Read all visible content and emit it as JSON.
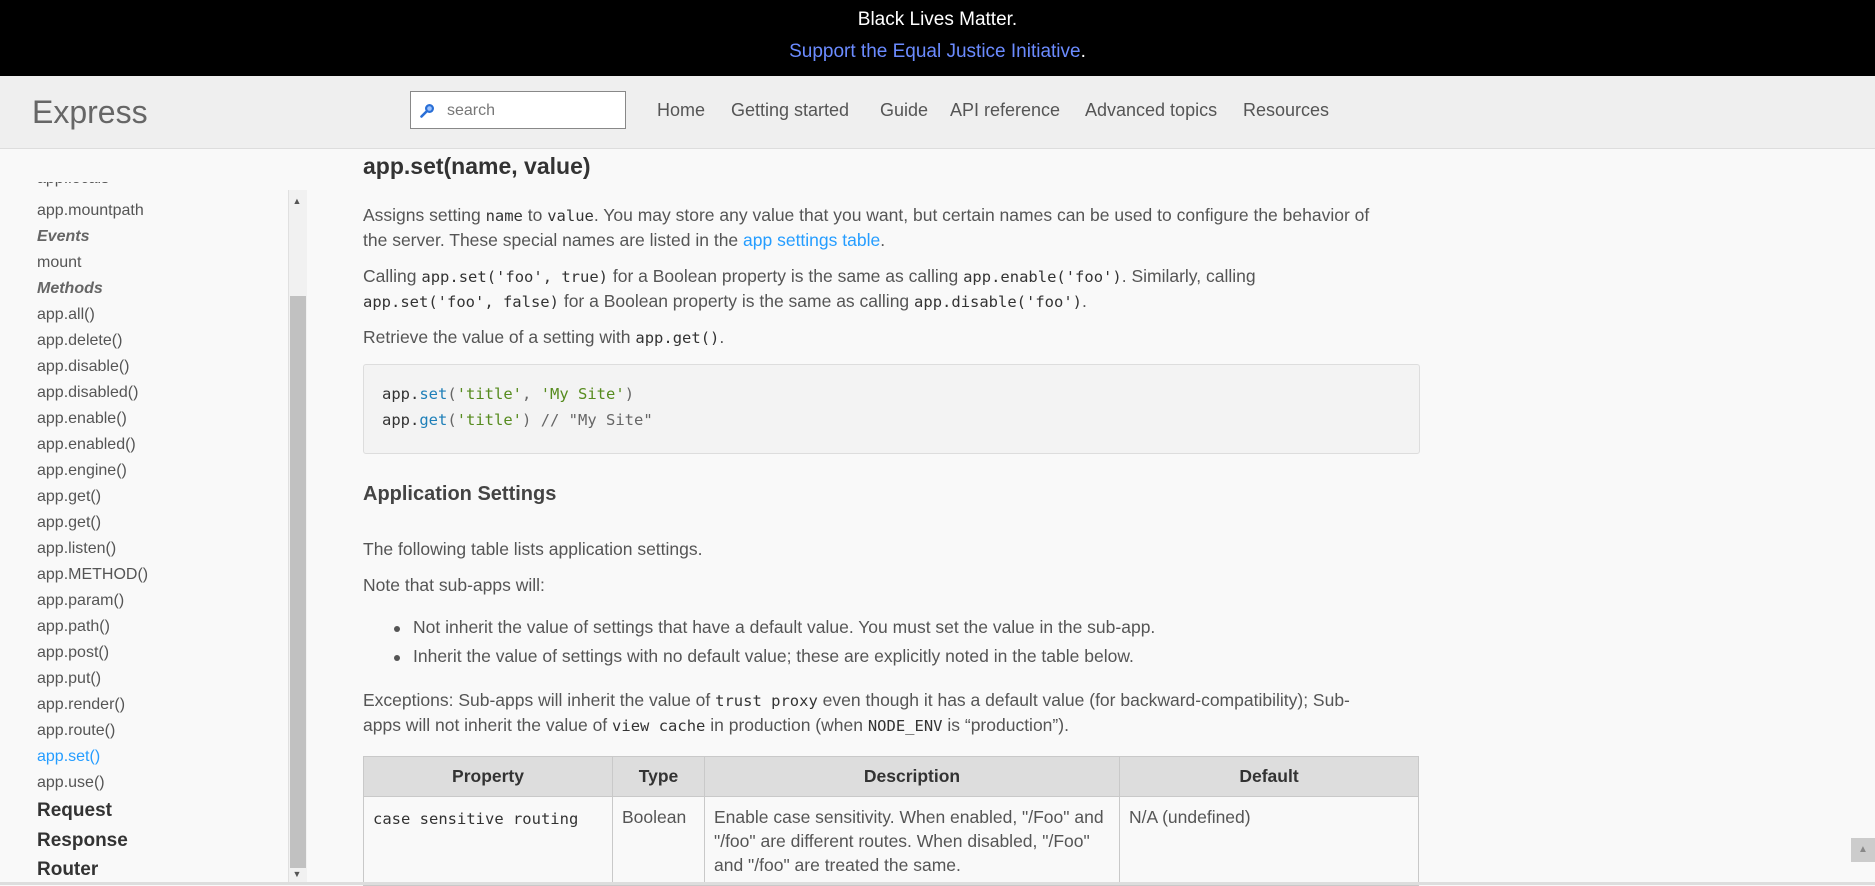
{
  "banner": {
    "line1": "Black Lives Matter.",
    "link": "Support the Equal Justice Initiative",
    "period": "."
  },
  "header": {
    "logo": "Express",
    "search_placeholder": "search",
    "nav": [
      "Home",
      "Getting started",
      "Guide",
      "API reference",
      "Advanced topics",
      "Resources"
    ]
  },
  "sidebar": {
    "clipped": "app.locals",
    "items": [
      {
        "label": "app.mountpath",
        "kind": "item"
      },
      {
        "label": "Events",
        "kind": "head"
      },
      {
        "label": "mount",
        "kind": "item"
      },
      {
        "label": "Methods",
        "kind": "head"
      },
      {
        "label": "app.all()",
        "kind": "item"
      },
      {
        "label": "app.delete()",
        "kind": "item"
      },
      {
        "label": "app.disable()",
        "kind": "item"
      },
      {
        "label": "app.disabled()",
        "kind": "item"
      },
      {
        "label": "app.enable()",
        "kind": "item"
      },
      {
        "label": "app.enabled()",
        "kind": "item"
      },
      {
        "label": "app.engine()",
        "kind": "item"
      },
      {
        "label": "app.get()",
        "kind": "item"
      },
      {
        "label": "app.get()",
        "kind": "item"
      },
      {
        "label": "app.listen()",
        "kind": "item"
      },
      {
        "label": "app.METHOD()",
        "kind": "item"
      },
      {
        "label": "app.param()",
        "kind": "item"
      },
      {
        "label": "app.path()",
        "kind": "item"
      },
      {
        "label": "app.post()",
        "kind": "item"
      },
      {
        "label": "app.put()",
        "kind": "item"
      },
      {
        "label": "app.render()",
        "kind": "item"
      },
      {
        "label": "app.route()",
        "kind": "item"
      },
      {
        "label": "app.set()",
        "kind": "active"
      },
      {
        "label": "app.use()",
        "kind": "item"
      }
    ],
    "sections": [
      "Request",
      "Response",
      "Router"
    ]
  },
  "main": {
    "title": "app.set(name, value)",
    "p1": {
      "a": "Assigns setting ",
      "code1": "name",
      "b": " to ",
      "code2": "value",
      "c": ". You may store any value that you want, but certain names can be used to configure the behavior of",
      "d": "the server. These special names are listed in the ",
      "link": "app settings table",
      "e": "."
    },
    "p2": {
      "a": "Calling ",
      "code1": "app.set('foo', true)",
      "b": " for a Boolean property is the same as calling ",
      "code2": "app.enable('foo')",
      "c": ". Similarly, calling",
      "code3": "app.set('foo', false)",
      "d": " for a Boolean property is the same as calling ",
      "code4": "app.disable('foo')",
      "e": "."
    },
    "p3": {
      "a": "Retrieve the value of a setting with ",
      "code": "app.get()",
      "b": "."
    },
    "code": {
      "l1_obj": "app",
      "l1_dot": ".",
      "l1_fn": "set",
      "l1_open": "(",
      "l1_s1": "'title'",
      "l1_comma": ", ",
      "l1_s2": "'My Site'",
      "l1_close": ")",
      "l2_obj": "app",
      "l2_dot": ".",
      "l2_fn": "get",
      "l2_open": "(",
      "l2_s1": "'title'",
      "l2_close": ")",
      "l2_comment": " // \"My Site\""
    },
    "subtitle": "Application Settings",
    "p4": "The following table lists application settings.",
    "p5": "Note that sub-apps will:",
    "bullets": [
      "Not inherit the value of settings that have a default value. You must set the value in the sub-app.",
      "Inherit the value of settings with no default value; these are explicitly noted in the table below."
    ],
    "p6": {
      "a": "Exceptions: Sub-apps will inherit the value of ",
      "code1": "trust proxy",
      "b": " even though it has a default value (for backward-compatibility); Sub-",
      "c": "apps will not inherit the value of ",
      "code2": "view cache",
      "d": " in production (when ",
      "code3": "NODE_ENV",
      "e": " is “production”)."
    },
    "table": {
      "headers": [
        "Property",
        "Type",
        "Description",
        "Default"
      ],
      "row1": {
        "property": "case sensitive routing",
        "type": "Boolean",
        "description": "Enable case sensitivity. When enabled, \"/Foo\" and \"/foo\" are different routes. When disabled, \"/Foo\" and \"/foo\" are treated the same.",
        "default": "N/A (undefined)"
      }
    }
  }
}
